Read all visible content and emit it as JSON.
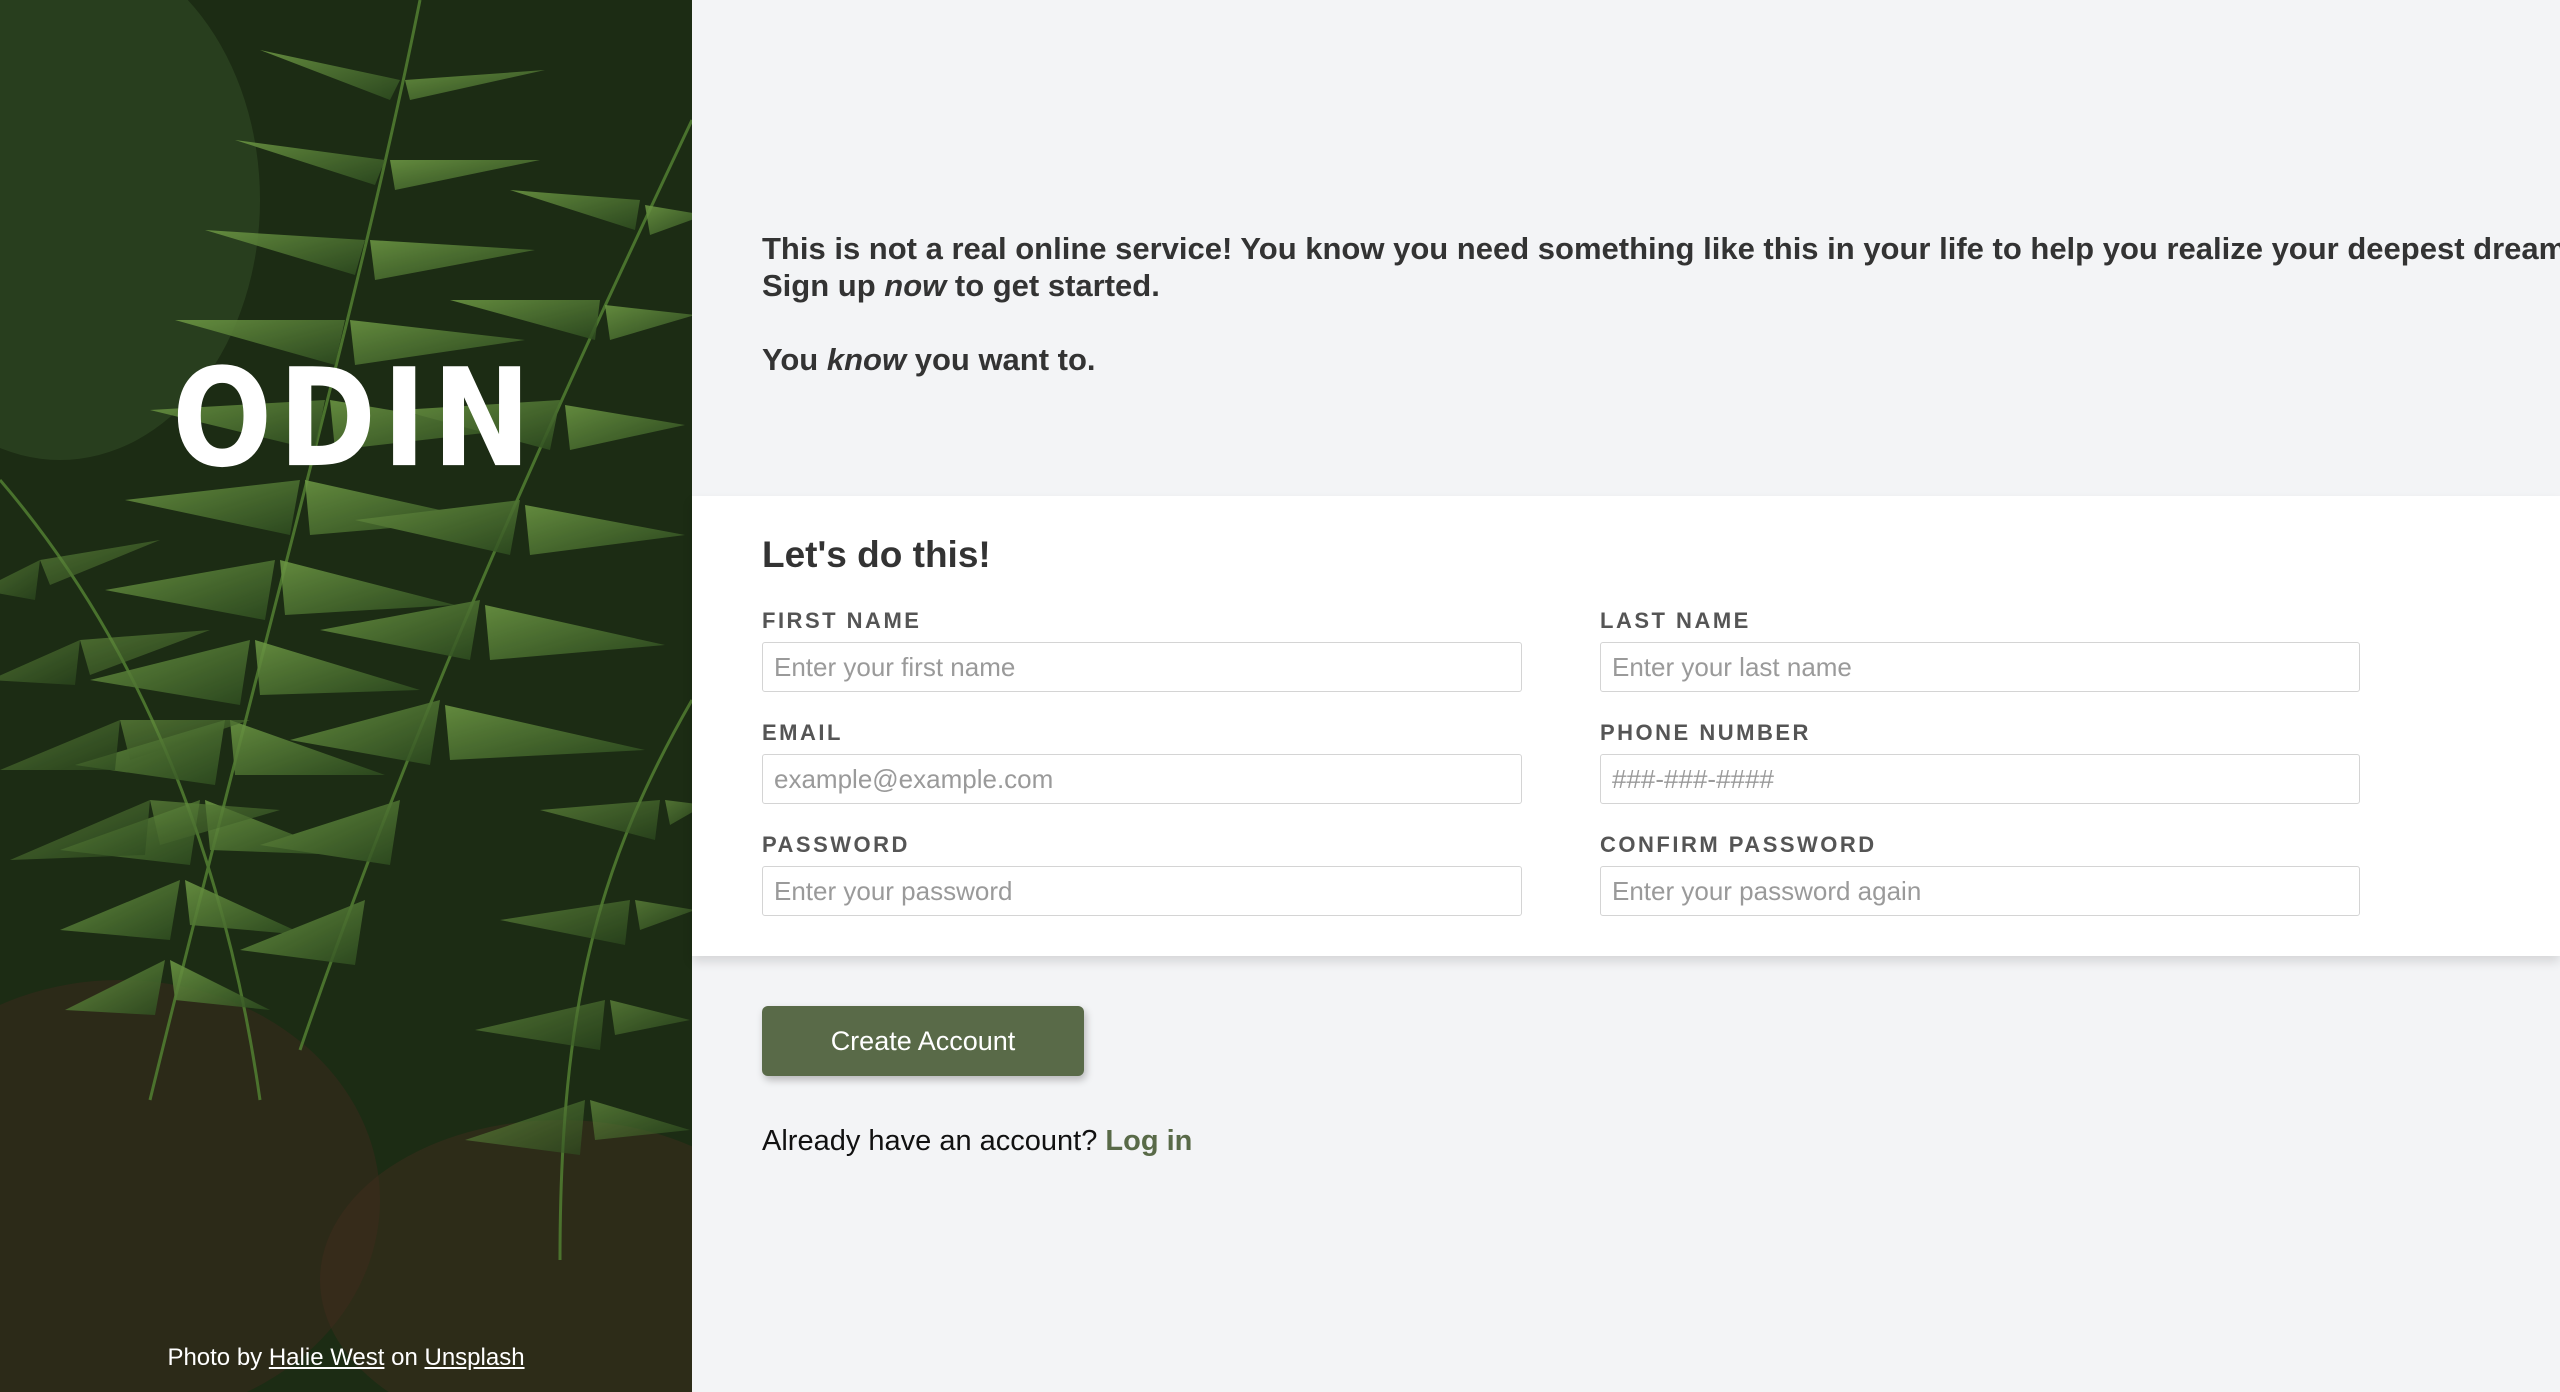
{
  "brand": {
    "name": "ODIN"
  },
  "credit": {
    "prefix": "Photo by",
    "author": "Halie West",
    "middle": "on",
    "site": "Unsplash"
  },
  "intro": {
    "line1": "This is not a real online service! You know you need something like this in your life to help you realize your deepest dreams.",
    "line2_a": "Sign up ",
    "line2_em": "now",
    "line2_b": " to get started.",
    "line3_a": "You ",
    "line3_em": "know",
    "line3_b": " you want to."
  },
  "form": {
    "title": "Let's do this!",
    "fields": {
      "first_name": {
        "label": "FIRST NAME",
        "placeholder": "Enter your first name"
      },
      "last_name": {
        "label": "LAST NAME",
        "placeholder": "Enter your last name"
      },
      "email": {
        "label": "EMAIL",
        "placeholder": "example@example.com"
      },
      "phone": {
        "label": "PHONE NUMBER",
        "placeholder": "###-###-####"
      },
      "password": {
        "label": "PASSWORD",
        "placeholder": "Enter your password"
      },
      "confirm_password": {
        "label": "CONFIRM PASSWORD",
        "placeholder": "Enter your password again"
      }
    }
  },
  "actions": {
    "create_label": "Create Account",
    "login_prompt": "Already have an account?",
    "login_link": "Log in"
  },
  "colors": {
    "accent": "#596a48",
    "background": "#f3f4f6",
    "card": "#ffffff",
    "text": "#333333"
  },
  "icons": {
    "logo": "viking-helmet-icon"
  }
}
